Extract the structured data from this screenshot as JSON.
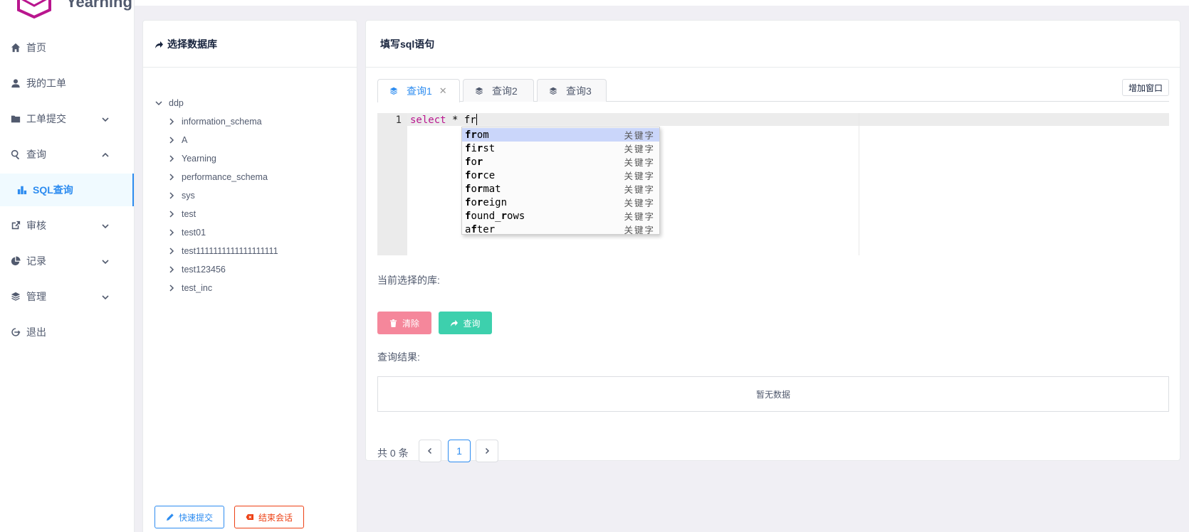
{
  "brand": {
    "name": "Yearning",
    "color": "#b9168e"
  },
  "sidebar": {
    "items": [
      {
        "label": "首页",
        "icon": "home-icon"
      },
      {
        "label": "我的工单",
        "icon": "user-icon"
      },
      {
        "label": "工单提交",
        "icon": "folder-icon",
        "expandable": true
      },
      {
        "label": "查询",
        "icon": "search-icon",
        "expandable": true,
        "expanded": true
      },
      {
        "label": "SQL查询",
        "icon": "bar-chart-icon",
        "active": true
      },
      {
        "label": "审核",
        "icon": "external-link-icon",
        "expandable": true
      },
      {
        "label": "记录",
        "icon": "pie-chart-icon",
        "expandable": true
      },
      {
        "label": "管理",
        "icon": "layers-icon",
        "expandable": true
      },
      {
        "label": "退出",
        "icon": "logout-icon"
      }
    ]
  },
  "db_panel": {
    "title": "选择数据库",
    "root": "ddp",
    "databases": [
      "information_schema",
      "A",
      "Yearning",
      "performance_schema",
      "sys",
      "test",
      "test01",
      "test1111111111111111111",
      "test123456",
      "test_inc"
    ],
    "quick_submit": "快速提交",
    "end_session": "结束会话"
  },
  "query_panel": {
    "title": "填写sql语句",
    "tabs": [
      {
        "label": "查询1",
        "active": true,
        "closable": true
      },
      {
        "label": "查询2"
      },
      {
        "label": "查询3"
      }
    ],
    "add_window": "增加窗口",
    "editor": {
      "line_number": "1",
      "keyword": "select",
      "rest": " * fr"
    },
    "autocomplete": {
      "prefix": "fr",
      "meta": "关键字",
      "items": [
        {
          "match": "fr",
          "rest": "om",
          "selected": true
        },
        {
          "match": "f",
          "mid": "i",
          "match2": "r",
          "rest": "st"
        },
        {
          "match": "f",
          "mid": "o",
          "match2": "r",
          "rest": ""
        },
        {
          "match": "f",
          "mid": "o",
          "match2": "r",
          "rest": "ce"
        },
        {
          "match": "f",
          "mid": "o",
          "match2": "r",
          "rest": "mat"
        },
        {
          "match": "f",
          "mid": "o",
          "match2": "r",
          "rest": "eign"
        },
        {
          "match": "f",
          "mid": "ound_",
          "match2": "r",
          "rest": "ows"
        },
        {
          "match": "",
          "mid": "a",
          "match2": "f",
          "rest": "ter"
        }
      ]
    },
    "current_db_label": "当前选择的库:",
    "clear_btn": "清除",
    "query_btn": "查询",
    "result_label": "查询结果:",
    "empty_text": "暂无数据",
    "pagination": {
      "total": "共 0 条",
      "current_page": "1"
    }
  }
}
